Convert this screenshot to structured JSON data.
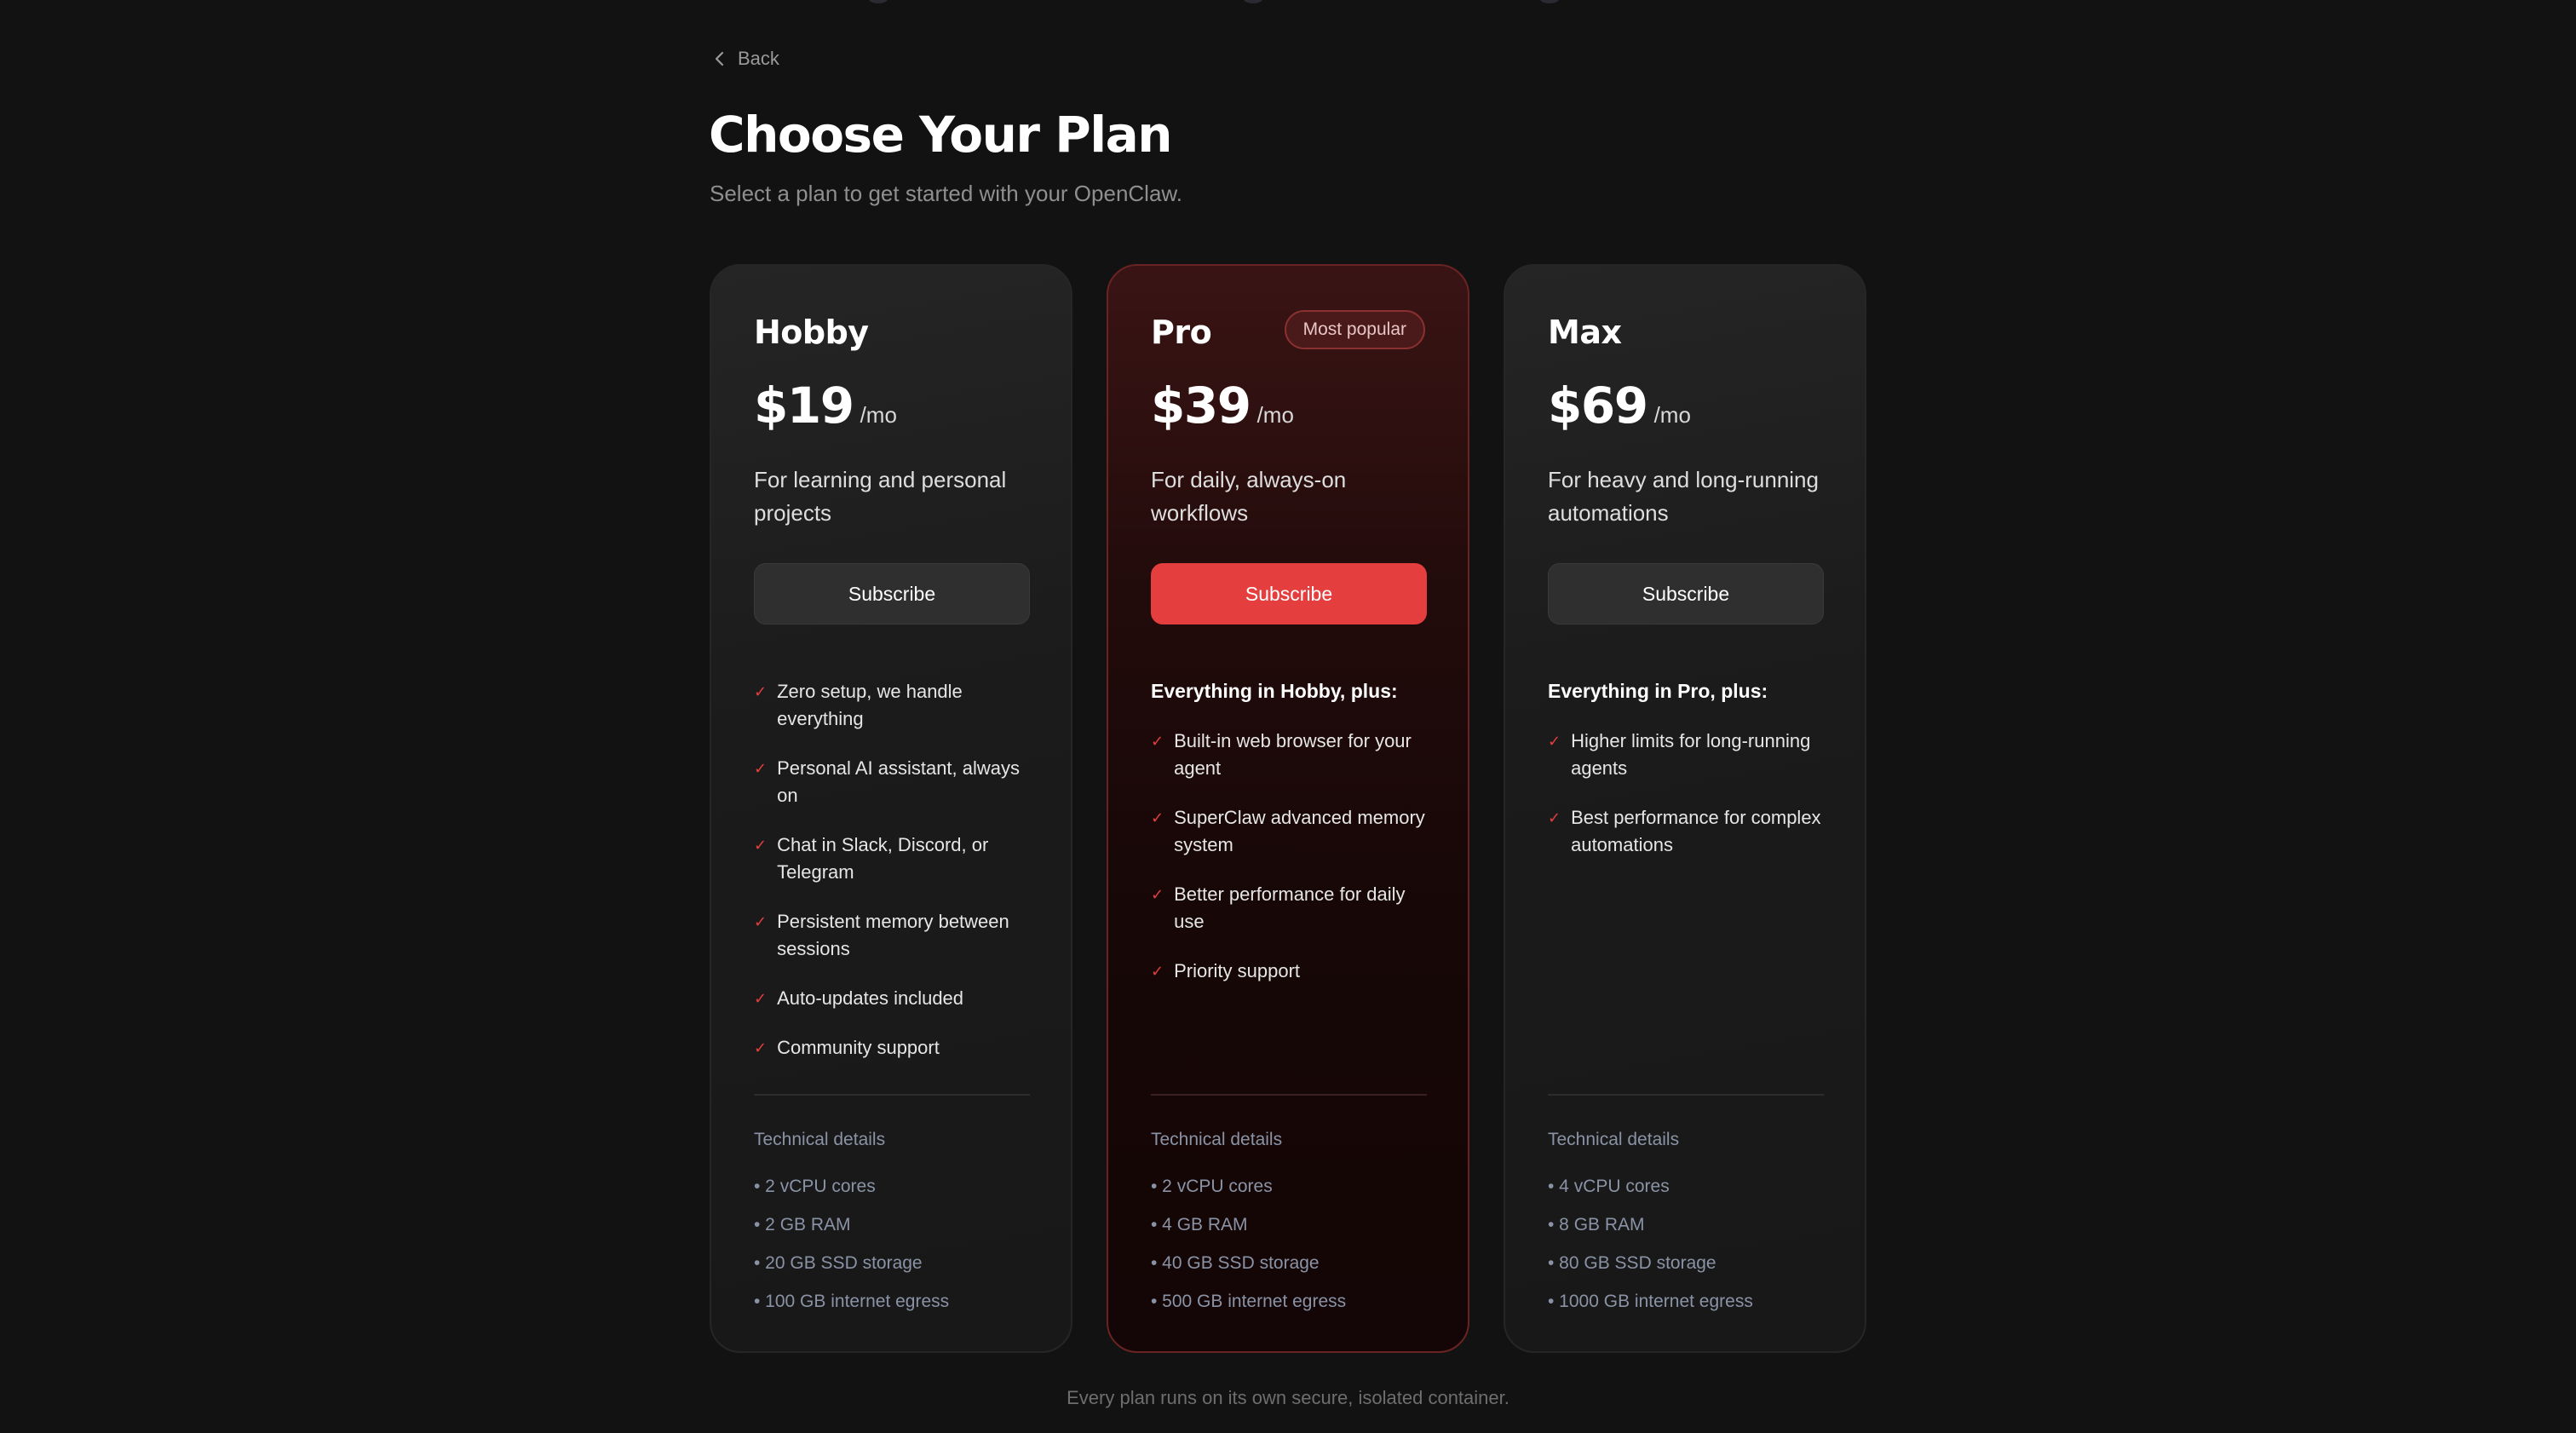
{
  "nav": {
    "back_label": "Back"
  },
  "header": {
    "title": "Choose Your Plan",
    "subtitle": "Select a plan to get started with your OpenClaw."
  },
  "plans": [
    {
      "name": "Hobby",
      "price": "$19",
      "period": "/mo",
      "description": "For learning and personal projects",
      "cta": "Subscribe",
      "features_heading": "",
      "features": [
        "Zero setup, we handle everything",
        "Personal AI assistant, always on",
        "Chat in Slack, Discord, or Telegram",
        "Persistent memory between sessions",
        "Auto-updates included",
        "Community support"
      ],
      "tech_title": "Technical details",
      "tech": [
        "• 2 vCPU cores",
        "• 2 GB RAM",
        "• 20 GB SSD storage",
        "• 100 GB internet egress"
      ]
    },
    {
      "name": "Pro",
      "badge": "Most popular",
      "price": "$39",
      "period": "/mo",
      "description": "For daily, always-on workflows",
      "cta": "Subscribe",
      "features_heading": "Everything in Hobby, plus:",
      "features": [
        "Built-in web browser for your agent",
        "SuperClaw advanced memory system",
        "Better performance for daily use",
        "Priority support"
      ],
      "tech_title": "Technical details",
      "tech": [
        "• 2 vCPU cores",
        "• 4 GB RAM",
        "• 40 GB SSD storage",
        "• 500 GB internet egress"
      ]
    },
    {
      "name": "Max",
      "price": "$69",
      "period": "/mo",
      "description": "For heavy and long-running automations",
      "cta": "Subscribe",
      "features_heading": "Everything in Pro, plus:",
      "features": [
        "Higher limits for long-running agents",
        "Best performance for complex automations"
      ],
      "tech_title": "Technical details",
      "tech": [
        "• 4 vCPU cores",
        "• 8 GB RAM",
        "• 80 GB SSD storage",
        "• 1000 GB internet egress"
      ]
    }
  ],
  "footer": {
    "note": "Every plan runs on its own secure, isolated container."
  },
  "colors": {
    "accent": "#e53e3e",
    "background": "#121212",
    "card": "#1c1c1c",
    "pro_card": "#1a0808"
  },
  "icons": {
    "back": "chevron-left-icon",
    "feature": "check-icon"
  }
}
